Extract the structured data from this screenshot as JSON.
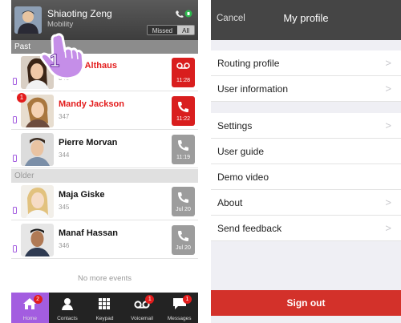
{
  "left": {
    "user": {
      "name": "Shiaoting Zeng",
      "status": "Mobility"
    },
    "filter": {
      "missed": "Missed",
      "all": "All"
    },
    "sections": {
      "past": "Past",
      "older": "Older"
    },
    "calls": [
      {
        "name": "Laura Althaus",
        "ext": "343",
        "time": "11:28",
        "missed": true,
        "kind": "voicemail"
      },
      {
        "name": "Mandy Jackson",
        "ext": "347",
        "time": "11:22",
        "missed": true,
        "kind": "call",
        "badge": "1"
      },
      {
        "name": "Pierre Morvan",
        "ext": "344",
        "time": "11:19",
        "missed": false,
        "kind": "call"
      },
      {
        "name": "Maja Giske",
        "ext": "345",
        "time": "Jul 20",
        "missed": false,
        "kind": "call"
      },
      {
        "name": "Manaf Hassan",
        "ext": "346",
        "time": "Jul 20",
        "missed": false,
        "kind": "call"
      }
    ],
    "no_more": "No more events",
    "step_number": "1",
    "tabs": [
      {
        "label": "Home",
        "badge": "2"
      },
      {
        "label": "Contacts",
        "badge": ""
      },
      {
        "label": "Keypad",
        "badge": ""
      },
      {
        "label": "Voicemail",
        "badge": "1"
      },
      {
        "label": "Messages",
        "badge": "1"
      }
    ]
  },
  "right": {
    "cancel": "Cancel",
    "title": "My profile",
    "menu": {
      "routing_profile": "Routing profile",
      "user_information": "User information",
      "settings": "Settings",
      "user_guide": "User guide",
      "demo_video": "Demo video",
      "about": "About",
      "send_feedback": "Send feedback"
    },
    "sign_out": "Sign out"
  },
  "colors": {
    "accent": "#a35de0",
    "missed": "#e31c1c",
    "signout": "#d3312a",
    "header": "#454545"
  }
}
